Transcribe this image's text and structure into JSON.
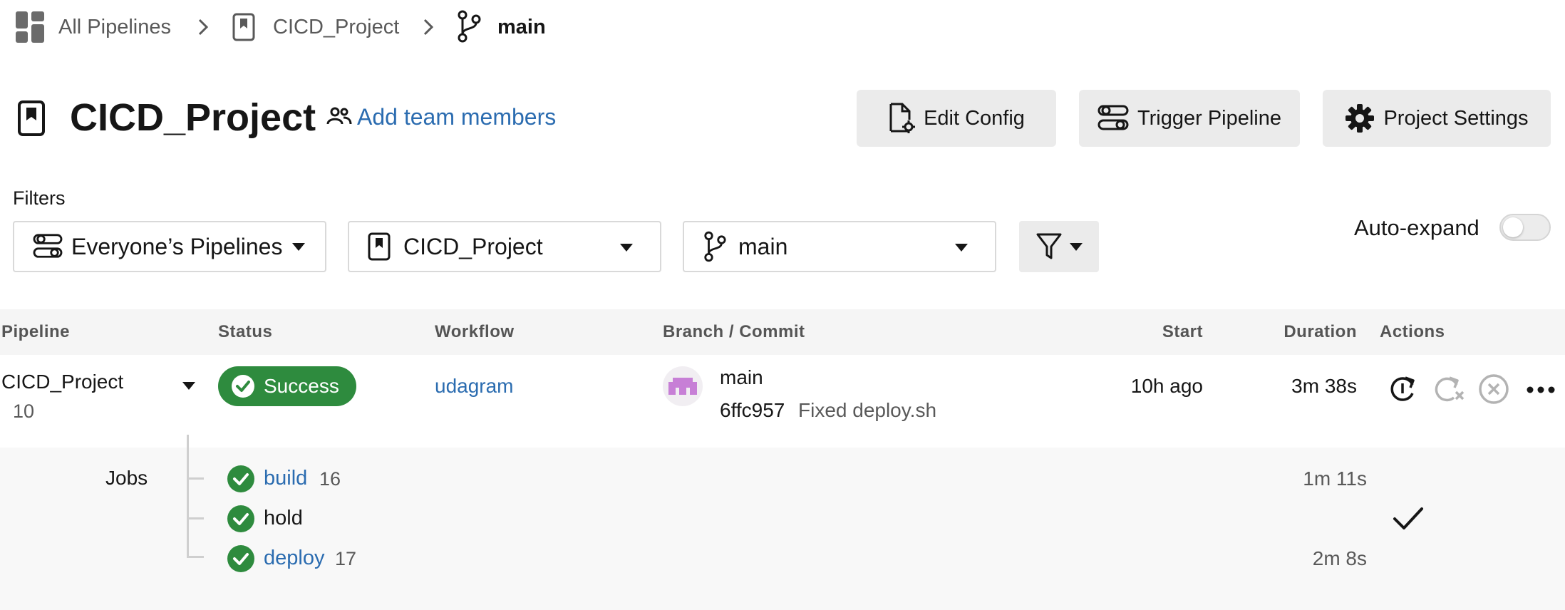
{
  "breadcrumb": {
    "all_pipelines": "All Pipelines",
    "project": "CICD_Project",
    "branch": "main"
  },
  "header": {
    "title": "CICD_Project",
    "add_team_members": "Add team members",
    "edit_config": "Edit Config",
    "trigger_pipeline": "Trigger Pipeline",
    "project_settings": "Project Settings"
  },
  "filters": {
    "label": "Filters",
    "pipelines_select": "Everyone’s Pipelines",
    "project_select": "CICD_Project",
    "branch_select": "main",
    "auto_expand_label": "Auto-expand",
    "auto_expand_on": false
  },
  "table": {
    "headers": {
      "pipeline": "Pipeline",
      "status": "Status",
      "workflow": "Workflow",
      "branch_commit": "Branch / Commit",
      "start": "Start",
      "duration": "Duration",
      "actions": "Actions"
    },
    "row": {
      "pipeline_name": "CICD_Project",
      "pipeline_number": "10",
      "status": "Success",
      "workflow": "udagram",
      "branch": "main",
      "commit_hash": "6ffc957",
      "commit_message": "Fixed deploy.sh",
      "start": "10h ago",
      "duration": "3m 38s"
    },
    "jobs_label": "Jobs",
    "jobs": [
      {
        "name": "build",
        "number": "16",
        "duration": "1m 11s",
        "link": true
      },
      {
        "name": "hold",
        "number": "",
        "duration": "",
        "link": false
      },
      {
        "name": "deploy",
        "number": "17",
        "duration": "2m 8s",
        "link": true
      }
    ]
  },
  "colors": {
    "success": "#2e8b3e",
    "link": "#2b6cb0",
    "avatar": "#c77fd6"
  },
  "icons": {
    "dashboard": "grid-icon",
    "chevron": "chevron-right-icon",
    "project": "bookmark-icon",
    "branch": "git-branch-icon",
    "team": "people-icon",
    "edit_config": "file-gear-icon",
    "trigger": "sliders-icon",
    "settings": "gear-icon",
    "filter": "filter-icon",
    "rerun": "rerun-icon",
    "rerun_failed": "rerun-failed-icon",
    "cancel": "cancel-icon",
    "more": "more-icon",
    "check": "check-circle-icon",
    "approved": "checkmark-icon"
  }
}
